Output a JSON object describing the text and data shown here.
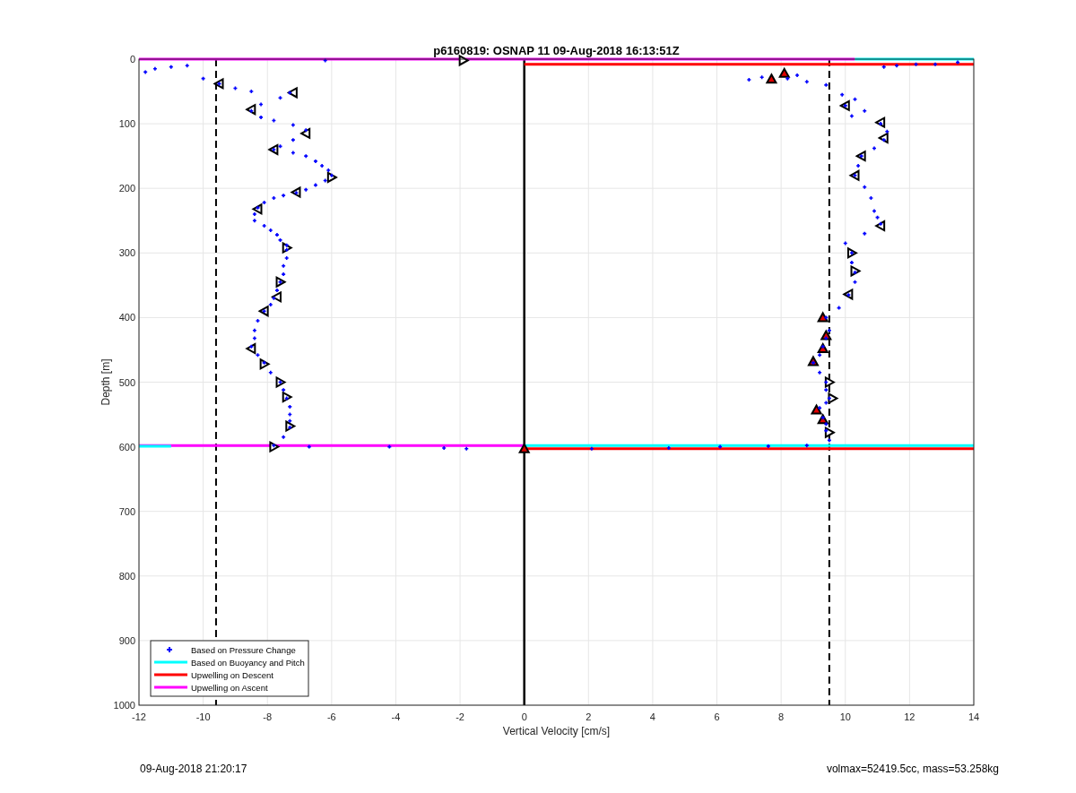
{
  "figure": {
    "chart_data": {
      "type": "scatter",
      "title": "p6160819: OSNAP 11 09-Aug-2018 16:13:51Z",
      "xlabel": "Vertical Velocity [cm/s]",
      "ylabel": "Depth [m]",
      "xlim": [
        -12,
        14
      ],
      "ylim": [
        1000,
        0
      ],
      "grid": true,
      "legend": true,
      "xticks": [
        -12,
        -10,
        -8,
        -6,
        -4,
        -2,
        0,
        2,
        4,
        6,
        8,
        10,
        12,
        14
      ],
      "yticks": [
        0,
        100,
        200,
        300,
        400,
        500,
        600,
        700,
        800,
        900,
        1000
      ],
      "series": [
        {
          "name": "Based on Pressure Change",
          "type": "scatter",
          "color": "#0000ff",
          "x": [
            -6.2,
            -11.8,
            -11.5,
            -11,
            -10.5,
            -10,
            -9.5,
            -9,
            -8.5,
            -7.3,
            -7.6,
            -8.2,
            -8.5,
            -8.2,
            -7.8,
            -7.2,
            -6.8,
            -7.2,
            -7.6,
            -7.8,
            -7.2,
            -6.8,
            -6.5,
            -6.3,
            -6.1,
            -6,
            -6.2,
            -6.5,
            -6.8,
            -7.1,
            -7.5,
            -7.8,
            -8.1,
            -8.3,
            -8.4,
            -8.4,
            -8.1,
            -7.9,
            -7.7,
            -7.6,
            -7.4,
            -7.4,
            -7.4,
            -7.5,
            -7.5,
            -7.6,
            -7.7,
            -7.8,
            -7.9,
            -8.1,
            -8.3,
            -8.4,
            -8.4,
            -8.5,
            -8.3,
            -8.1,
            -7.9,
            -7.6,
            -7.5,
            -7.4,
            -7.3,
            -7.3,
            -7.3,
            -7.3,
            -7.5,
            -7.8,
            -6.7,
            -4.2,
            -2.5,
            -1.8,
            2.1,
            4.5,
            6.1,
            7.6,
            8.8,
            9.5,
            9.4,
            9.4,
            9.3,
            9.2,
            9.4,
            9.5,
            9.4,
            9.4,
            9.2,
            9.0,
            9.2,
            9.3,
            9.4,
            9.5,
            9.4,
            9.8,
            10.1,
            10.3,
            10.3,
            10.2,
            10.2,
            10.0,
            10.6,
            11.1,
            11.0,
            10.9,
            10.8,
            10.6,
            10.3,
            10.4,
            10.5,
            10.9,
            11.2,
            11.3,
            11.1,
            10.2,
            10.6,
            10,
            10.3,
            9.9,
            9.4,
            8.8,
            8.2,
            7.0,
            7.4,
            8.5,
            11.2,
            11.6,
            12.2,
            12.8,
            13.5
          ],
          "values": [
            2,
            20,
            15,
            12,
            10,
            30,
            38,
            45,
            50,
            52,
            60,
            70,
            80,
            90,
            95,
            102,
            110,
            125,
            135,
            140,
            145,
            150,
            158,
            165,
            172,
            180,
            188,
            195,
            202,
            207,
            211,
            215,
            222,
            230,
            240,
            250,
            258,
            265,
            272,
            280,
            288,
            295,
            308,
            320,
            333,
            345,
            358,
            370,
            380,
            390,
            405,
            420,
            432,
            445,
            458,
            470,
            485,
            500,
            512,
            525,
            538,
            550,
            560,
            570,
            585,
            598,
            600,
            600,
            602,
            603,
            603,
            602,
            600,
            599,
            598,
            590,
            575,
            565,
            555,
            540,
            532,
            525,
            512,
            500,
            485,
            470,
            458,
            445,
            432,
            420,
            400,
            385,
            365,
            345,
            330,
            315,
            300,
            285,
            270,
            255,
            245,
            235,
            215,
            198,
            180,
            165,
            150,
            138,
            125,
            112,
            100,
            88,
            80,
            72,
            62,
            55,
            40,
            35,
            30,
            32,
            28,
            25,
            12,
            10,
            8,
            8,
            5
          ]
        },
        {
          "name": "Based on Buoyancy and Pitch",
          "type": "line",
          "color": "#00ffff",
          "x": [
            10.3,
            14
          ],
          "values": [
            0,
            0
          ]
        },
        {
          "name": "Upwelling on Descent",
          "type": "line",
          "color": "#ff0000",
          "x": [
            0,
            14
          ],
          "values": [
            8,
            8
          ]
        },
        {
          "name": "Upwelling on Ascent",
          "type": "line",
          "color": "#ff00ff",
          "x": [
            -12,
            10.3
          ],
          "values": [
            0,
            0
          ]
        },
        {
          "type": "line",
          "color": "#00ffff",
          "x": [
            -12,
            -11
          ],
          "values": [
            599,
            599
          ]
        },
        {
          "type": "line",
          "color": "#00ffff",
          "x": [
            0,
            14
          ],
          "values": [
            598,
            598
          ]
        },
        {
          "type": "line",
          "color": "#ff0000",
          "x": [
            0,
            14
          ],
          "values": [
            603,
            603
          ]
        },
        {
          "type": "line",
          "color": "#ff00ff",
          "x": [
            -12,
            0
          ],
          "values": [
            598,
            598
          ]
        },
        {
          "type": "scatter",
          "marker": "triangle-left",
          "color": "#ffffff",
          "x": [
            -9.5,
            -7.2,
            -8.5,
            -6.8,
            -7.8,
            -7.1,
            -8.3,
            -7.7,
            -8.1,
            -8.5,
            10,
            11.1,
            11.2,
            10.5,
            10.3,
            11.1,
            10.1
          ],
          "values": [
            38,
            52,
            78,
            115,
            140,
            206,
            232,
            368,
            390,
            448,
            72,
            98,
            122,
            150,
            180,
            258,
            364
          ]
        },
        {
          "type": "scatter",
          "marker": "triangle-right",
          "color": "#ffffff",
          "x": [
            -1.9,
            -6,
            -7.4,
            -7.6,
            -8.1,
            -7.6,
            -7.4,
            -7.3,
            -7.8,
            10.2,
            10.3,
            9.5,
            9.6,
            9.5
          ],
          "values": [
            2,
            183,
            292,
            345,
            472,
            500,
            523,
            568,
            600,
            300,
            328,
            500,
            525,
            578
          ]
        },
        {
          "type": "scatter",
          "marker": "triangle-up",
          "color": "#e00000",
          "x": [
            0,
            8.1,
            7.7,
            9.3,
            9.4,
            9.3,
            9.0,
            9.1,
            9.3
          ],
          "values": [
            603,
            22,
            31,
            400,
            428,
            448,
            468,
            543,
            558
          ]
        }
      ],
      "ref_lines": [
        {
          "axis": "x",
          "value": 0
        },
        {
          "axis": "x",
          "value": -9.6
        },
        {
          "axis": "x",
          "value": 9.5
        }
      ]
    }
  },
  "footer": {
    "timestamp": "09-Aug-2018 21:20:17",
    "summary": "volmax=52419.5cc, mass=53.258kg"
  }
}
